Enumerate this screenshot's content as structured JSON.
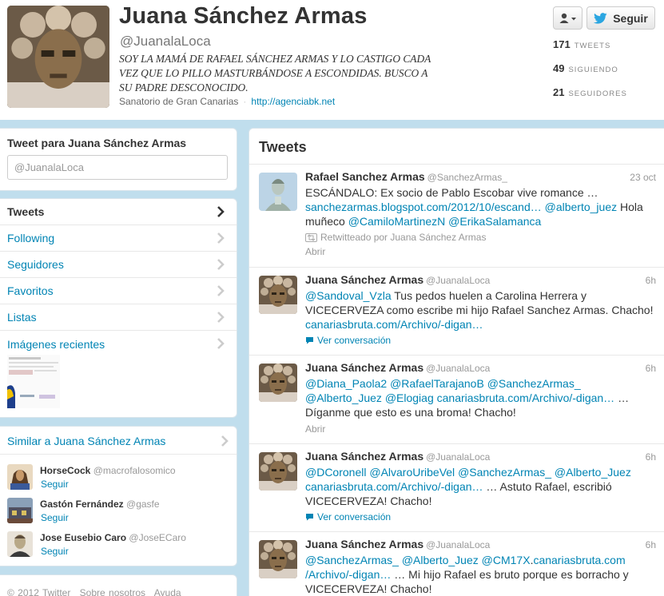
{
  "profile": {
    "full_name": "Juana Sánchez Armas",
    "screen_name": "@JuanalaLoca",
    "bio": "SOY LA MAMÁ DE RAFAEL SÁNCHEZ ARMAS Y LO CASTIGO CADA VEZ QUE LO PILLO MASTURBÁNDOSE A ESCONDIDAS. BUSCO A SU PADRE DESCONOCIDO.",
    "location": "Sanatorio de Gran Canarias",
    "url": "http://agenciabk.net",
    "follow_label": "Seguir",
    "stats": [
      {
        "num": "171",
        "label": "TWEETS"
      },
      {
        "num": "49",
        "label": "SIGUIENDO"
      },
      {
        "num": "21",
        "label": "SEGUIDORES"
      }
    ]
  },
  "tweet_box": {
    "title": "Tweet para Juana Sánchez Armas",
    "value": "@JuanalaLoca"
  },
  "nav": {
    "items": [
      {
        "label": "Tweets"
      },
      {
        "label": "Following"
      },
      {
        "label": "Seguidores"
      },
      {
        "label": "Favoritos"
      },
      {
        "label": "Listas"
      },
      {
        "label": "Imágenes recientes"
      }
    ]
  },
  "similar": {
    "title": "Similar a Juana Sánchez Armas",
    "follow_label": "Seguir",
    "users": [
      {
        "name": "HorseCock",
        "screen_name": "@macrofalosomico"
      },
      {
        "name": "Gastón Fernández",
        "screen_name": "@gasfe"
      },
      {
        "name": "Jose Eusebio Caro",
        "screen_name": "@JoseECaro"
      }
    ]
  },
  "footer": {
    "items": [
      "© 2012 Twitter",
      "Sobre nosotros",
      "Ayuda"
    ]
  },
  "timeline": {
    "title": "Tweets",
    "tweets": [
      {
        "name": "Rafael Sanchez Armas",
        "handle": "@SanchezArmas_",
        "time": "23 oct",
        "line1": "ESCÁNDALO: Ex socio de Pablo Escobar vive romance …",
        "line2_link1": "sanchezarmas.blogspot.com/2012/10/escand…",
        "line2_link2": "@alberto_juez",
        "line2_text": " Hola",
        "line3_text": "muñeco ",
        "line3_link1": "@CamiloMartinezN",
        "line3_link2": "@ErikaSalamanca",
        "retweet": "Retwitteado por Juana Sánchez Armas",
        "action": "Abrir"
      },
      {
        "name": "Juana Sánchez Armas",
        "handle": "@JuanalaLoca",
        "time": "6h",
        "line1_link": "@Sandoval_Vzla",
        "line1_text": " Tus pedos huelen a Carolina Herrera y",
        "line2": "VICECERVEZA como escribe mi hijo Rafael Sanchez Armas. Chacho!",
        "line3_link": "canariasbruta.com/Archivo/-digan…",
        "action": "Ver conversación"
      },
      {
        "name": "Juana Sánchez Armas",
        "handle": "@JuanalaLoca",
        "time": "6h",
        "line1_links": [
          "@Diana_Paola2",
          "@RafaelTarajanoB",
          "@SanchezArmas_"
        ],
        "line2_links": [
          "@Alberto_Juez",
          "@Elogiag",
          "canariasbruta.com/Archivo/-digan…"
        ],
        "line2_text": " …",
        "line3": "Díganme que esto es una broma! Chacho!",
        "action": "Abrir"
      },
      {
        "name": "Juana Sánchez Armas",
        "handle": "@JuanalaLoca",
        "time": "6h",
        "line1_links": [
          "@DCoronell",
          "@AlvaroUribeVel",
          "@SanchezArmas_",
          "@Alberto_Juez"
        ],
        "line2_link": "canariasbruta.com/Archivo/-digan…",
        "line2_text": " … Astuto Rafael, escribió",
        "line3": "VICECERVEZA! Chacho!",
        "action": "Ver conversación"
      },
      {
        "name": "Juana Sánchez Armas",
        "handle": "@JuanalaLoca",
        "time": "6h",
        "line1_links": [
          "@SanchezArmas_",
          "@Alberto_Juez",
          "@CM17X",
          "canariasbruta.com"
        ],
        "line2_link": "/Archivo/-digan…",
        "line2_text": " … Mi hijo Rafael es bruto porque es borracho y",
        "line3": "VICECERVEZA! Chacho!"
      }
    ]
  },
  "colors": {
    "link": "#0084b4",
    "background": "#c0deed",
    "text": "#333333",
    "muted": "#999999"
  }
}
